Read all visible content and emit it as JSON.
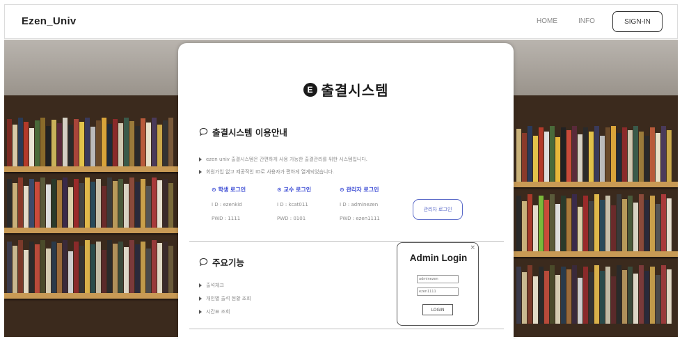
{
  "nav": {
    "brand": "Ezen_Univ",
    "home": "HOME",
    "info": "INFO",
    "signin": "SIGN-IN"
  },
  "hero": {
    "logo_letter": "E",
    "title": "출결시스템"
  },
  "guide": {
    "title": "출결시스템 이용안내",
    "bullets": [
      "ezen univ 출결시스템은 간편하게 사용 가능한 출결관리를 위한 시스템입니다.",
      "회원가입 없고 제공적인 ID로 사용자가 편하게 열게되었습니다."
    ],
    "logins": [
      {
        "label": "학생 로그인",
        "id": "I D : ezenkid",
        "pwd": "PWD : 1111"
      },
      {
        "label": "교수 로그인",
        "id": "I D : kcat011",
        "pwd": "PWD : 0101"
      },
      {
        "label": "관리자 로그인",
        "id": "I D : adminezen",
        "pwd": "PWD : ezen1111"
      }
    ],
    "admin_button": "관리자 로그인"
  },
  "features": {
    "title": "주요기능",
    "bullets": [
      "출석체크",
      "개인별 출석 현황 조회",
      "시간표 조회"
    ]
  },
  "popup": {
    "close": "×",
    "title": "Admin Login",
    "id_placeholder": "adminezen",
    "pw_placeholder": "ezen1111",
    "login_button": "LOGIN"
  },
  "colors": {
    "accent": "#3b4bd4",
    "shelf_wood": "#c89a55"
  }
}
